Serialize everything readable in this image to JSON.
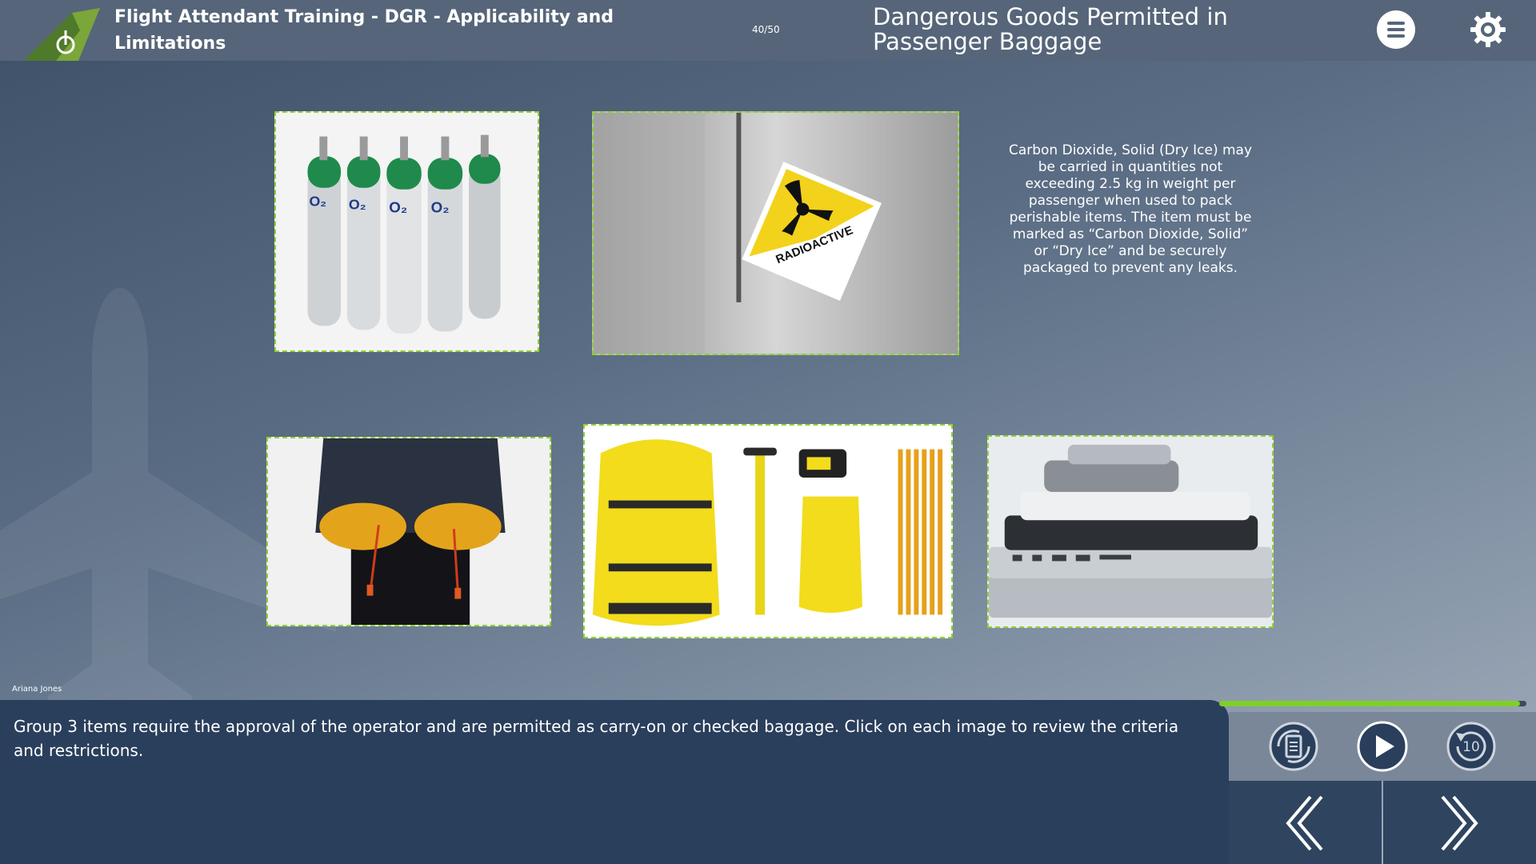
{
  "header": {
    "course_title": "Flight Attendant Training - DGR - Applicability and Limitations",
    "page_counter": "40/50",
    "slide_title": "Dangerous Goods Permitted in Passenger Baggage"
  },
  "content": {
    "info_text": "Carbon Dioxide, Solid (Dry Ice) may be carried in quantities not exceeding 2.5 kg in weight per passenger when used to pack perishable items. The item must be marked as “Carbon Dioxide, Solid” or “Dry Ice” and be securely packaged to prevent any leaks.",
    "oxygen_label": "O₂",
    "radioactive_label": "RADIOACTIVE"
  },
  "narration": {
    "narrator": "Ariana Jones",
    "text": "Group 3 items require the approval of the operator and are permitted as carry-on or checked baggage. Click on each image to review the criteria and restrictions."
  },
  "player": {
    "progress_fraction": 0.98,
    "replay_seconds": "10"
  },
  "colors": {
    "accent_green": "#8fd12f",
    "narration_bg": "#2a3f5c",
    "header_bg": "#566579"
  }
}
